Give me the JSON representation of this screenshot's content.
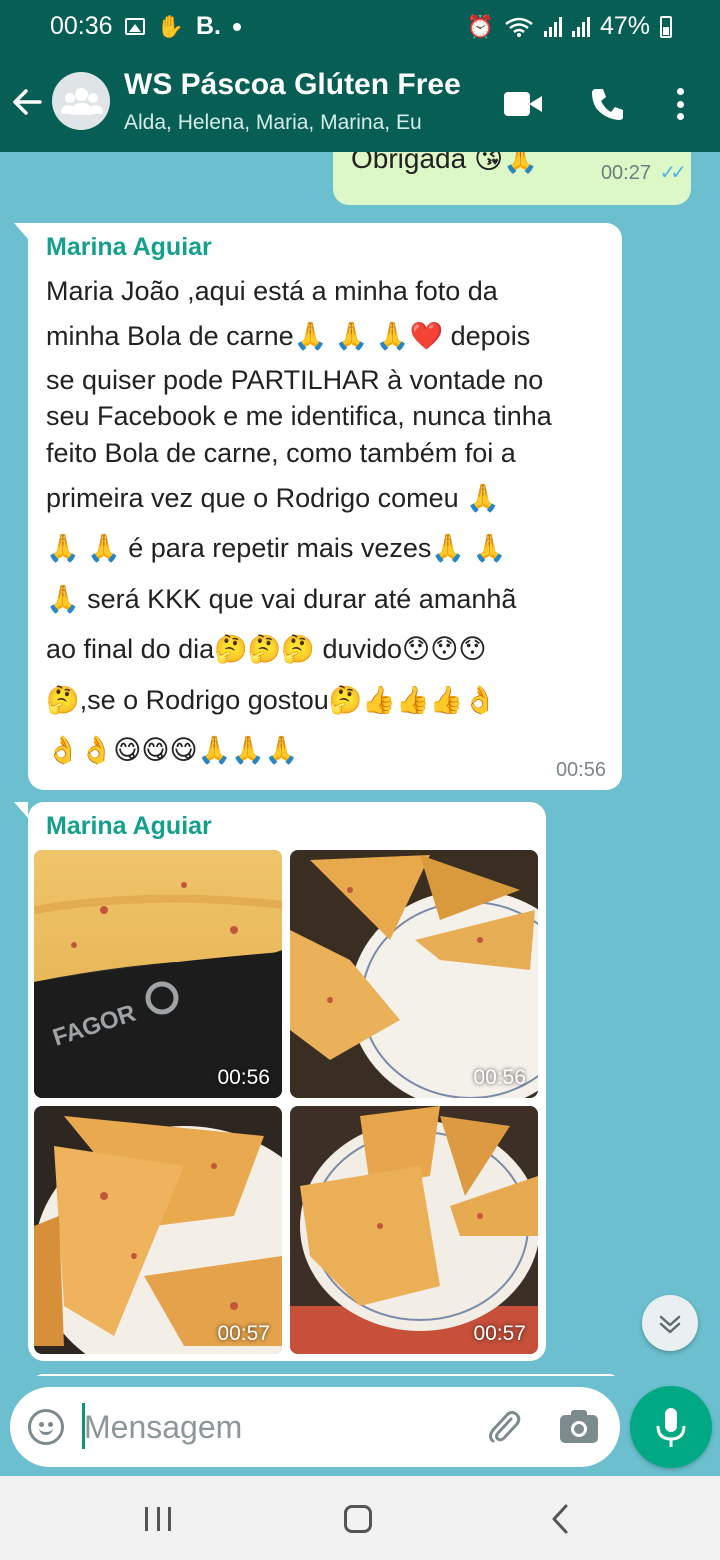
{
  "status_bar": {
    "time": "00:36",
    "left_glyph": "B.",
    "battery": "47%",
    "icons": [
      "gallery-icon",
      "hand-icon",
      "alarm-icon",
      "wifi-icon",
      "signal-icon",
      "battery-icon"
    ]
  },
  "header": {
    "title": "WS Páscoa Glúten Free",
    "subtitle": "Alda, Helena, Maria, Marina, Eu",
    "actions": [
      "video-call",
      "voice-call",
      "more-options"
    ]
  },
  "messages": {
    "outgoing_partial": {
      "text": "Obrigada 😘🙏",
      "time": "00:27",
      "status": "read"
    },
    "text_message": {
      "sender": "Marina Aguiar",
      "lines": [
        "Maria João ,aqui está a minha foto da",
        "minha Bola de carne🙏 🙏 🙏❤️ depois",
        "se quiser pode PARTILHAR à vontade no",
        "seu Facebook e me identifica, nunca tinha",
        "feito Bola de carne, como também foi a",
        "primeira vez que o Rodrigo comeu 🙏",
        "🙏 🙏 é para repetir mais vezes🙏 🙏",
        "🙏 será KKK que vai durar até amanhã",
        "ao final do dia🤔🤔🤔 duvido😯😯😯",
        "🤔,se o Rodrigo gostou🤔👍👍👍👌",
        "👌👌😋😋😋🙏🙏🙏"
      ],
      "time": "00:56"
    },
    "photo_album": {
      "sender": "Marina Aguiar",
      "photos": [
        {
          "name": "meat-bread-closeup-on-stove",
          "time": "00:56",
          "stove_brand": "FAGOR"
        },
        {
          "name": "meat-bread-slices-on-plate",
          "time": "00:56"
        },
        {
          "name": "meat-bread-slice-closeup",
          "time": "00:57"
        },
        {
          "name": "meat-bread-slices-plate-top",
          "time": "00:57"
        }
      ]
    }
  },
  "input_bar": {
    "placeholder": "Mensagem"
  },
  "colors": {
    "header": "#075e54",
    "chat_background": "#6bbfce",
    "incoming_bubble": "#ffffff",
    "outgoing_bubble": "#dcf8c6",
    "sender_name": "#15a08e",
    "mic_button": "#00a884",
    "read_ticks": "#4fb6ec"
  }
}
